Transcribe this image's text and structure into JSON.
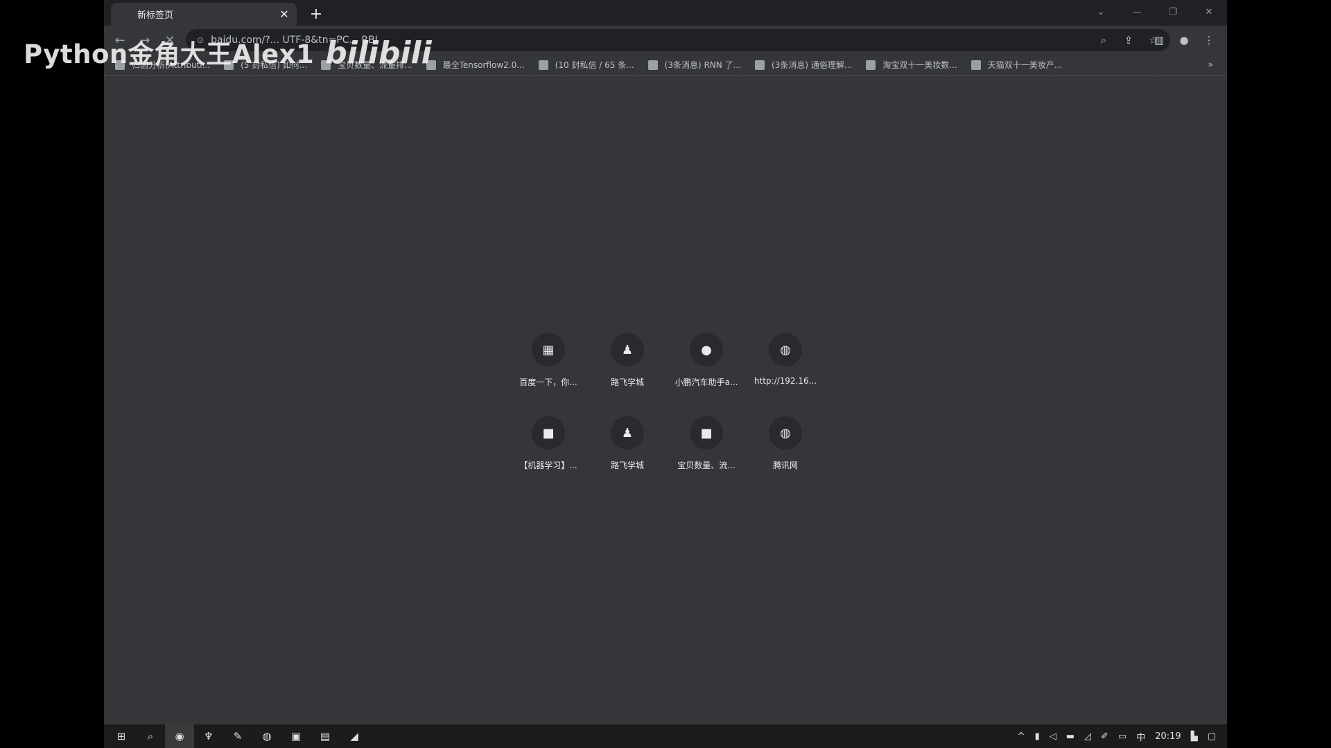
{
  "browser": {
    "tab_title": "新标签页",
    "tab_close": "✕",
    "new_tab": "+",
    "url": "baidu.com/?... UTF-8&tn=PC... RBI",
    "window_controls": [
      "⌄",
      "—",
      "❐",
      "✕"
    ]
  },
  "bookmarks": [
    "归因分析(Attributi...",
    "(5 封私信) 如何...",
    "宝贝数量、流量排...",
    "最全Tensorflow2.0...",
    "(10 封私信 / 65 条...",
    "(3条消息) RNN 了...",
    "(3条消息) 通俗理解...",
    "淘宝双十一美妆数...",
    "天猫双十一美妆产..."
  ],
  "bookmarks_more": "»",
  "shortcuts": [
    {
      "label": "百度一下，你...",
      "icon": "grid-icon"
    },
    {
      "label": "路飞学城",
      "icon": "person-icon"
    },
    {
      "label": "小鹏汽车助手a...",
      "icon": "circle-icon"
    },
    {
      "label": "http://192.16...",
      "icon": "globe-icon"
    },
    {
      "label": "【机器学习】...",
      "icon": "square-icon"
    },
    {
      "label": "路飞学城",
      "icon": "person-icon"
    },
    {
      "label": "宝贝数量、流...",
      "icon": "square-icon"
    },
    {
      "label": "腾讯网",
      "icon": "globe-icon"
    }
  ],
  "taskbar": {
    "ime": "中",
    "time": "20:19"
  },
  "watermark": {
    "text": "Python金角大王Alex1",
    "logo": "bilibili"
  }
}
